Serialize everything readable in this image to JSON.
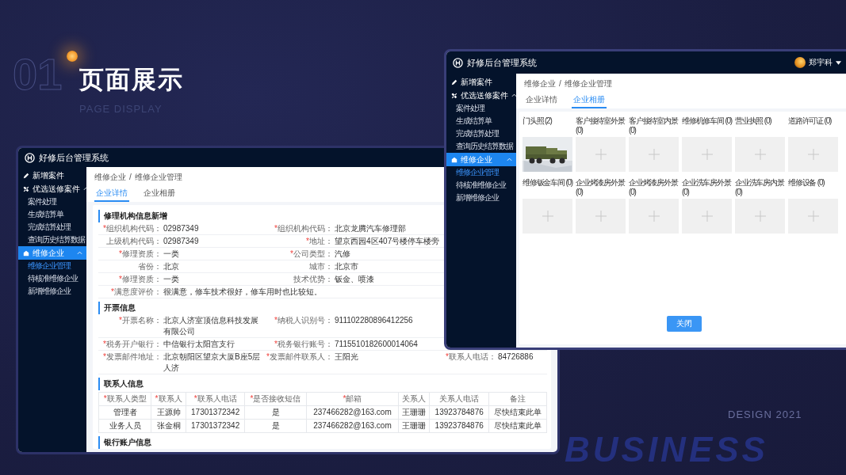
{
  "hero": {
    "number": "01",
    "title": "页面展示",
    "subtitle": "PAGE DISPLAY",
    "design_label": "DESIGN 2021",
    "backdrop_word": "BUSINESS"
  },
  "back_window": {
    "title": "好修后台管理系统",
    "sidebar": [
      {
        "label": "新增案件",
        "selected": false
      },
      {
        "label": "优选送修案件",
        "selected": false,
        "expanded": true,
        "children": [
          {
            "label": "案件处理",
            "selected": false
          },
          {
            "label": "生成结算单",
            "selected": false
          },
          {
            "label": "完成结算处理",
            "selected": false
          },
          {
            "label": "查询历史结算数据",
            "selected": false
          }
        ]
      },
      {
        "label": "维修企业",
        "selected": true,
        "expanded": true,
        "children": [
          {
            "label": "维修企业管理",
            "selected": true
          },
          {
            "label": "待核准维修企业",
            "selected": false
          },
          {
            "label": "新增维修企业",
            "selected": false
          }
        ]
      }
    ],
    "breadcrumb": {
      "items": [
        "维修企业",
        "维修企业管理"
      ],
      "separator": "/"
    },
    "tabs": [
      {
        "label": "企业详情",
        "selected": true
      },
      {
        "label": "企业相册",
        "selected": false
      }
    ],
    "sections": [
      {
        "title": "修理机构信息新增",
        "kind": "fields",
        "rows": [
          [
            {
              "mark": "*",
              "label": "组织机构代码：",
              "value": "02987349"
            },
            {
              "mark": "*",
              "label": "组织机构代码：",
              "value": "北京龙腾汽车修理部"
            }
          ],
          [
            {
              "label": "上级机构代码：",
              "value": "02987349"
            },
            {
              "mark": "*",
              "label": "地址：",
              "value": "望京西园4区407号楼停车楼旁"
            }
          ],
          [
            {
              "mark": "*",
              "label": "修理资质：",
              "value": "一类"
            },
            {
              "mark": "*",
              "label": "公司类型：",
              "value": "汽修"
            }
          ],
          [
            {
              "label": "省份：",
              "value": "北京"
            },
            {
              "label": "城市：",
              "value": "北京市"
            }
          ],
          [
            {
              "mark": "*",
              "label": "修理资质：",
              "value": "一类"
            },
            {
              "label": "技术优势：",
              "value": "钣金、喷漆"
            }
          ],
          [
            {
              "mark": "*",
              "label": "满意度评价：",
              "value": "很满意，修车技术很好，修车用时也比较短。"
            }
          ]
        ]
      },
      {
        "title": "开票信息",
        "kind": "fields",
        "rows": [
          [
            {
              "mark": "*",
              "label": "开票名称：",
              "value": "北京人济室顶信息科技发展有限公司"
            },
            {
              "mark": "*",
              "label": "纳税人识别号：",
              "value": "911102280896412256"
            }
          ],
          [
            {
              "mark": "*",
              "label": "税务开户银行：",
              "value": "中信银行太阳宫支行"
            },
            {
              "mark": "*",
              "label": "税务银行账号：",
              "value": "7115510182600014064"
            }
          ],
          [
            {
              "mark": "*",
              "label": "发票邮件地址：",
              "value": "北京朝阳区望京大厦B座5层人济"
            },
            {
              "mark": "*",
              "label": "发票邮件联系人：",
              "value": "王阳光"
            },
            {
              "mark": "*",
              "label": "联系人电话：",
              "value": "84726886"
            }
          ]
        ]
      },
      {
        "title": "联系人信息",
        "kind": "table",
        "columns": [
          {
            "mark": "*",
            "label": "联系人类型"
          },
          {
            "mark": "*",
            "label": "联系人"
          },
          {
            "mark": "*",
            "label": "联系人电话"
          },
          {
            "mark": "*",
            "label": "是否接收短信"
          },
          {
            "mark": "*",
            "label": "邮箱"
          },
          {
            "label": "关系人"
          },
          {
            "label": "关系人电话"
          },
          {
            "label": "备注"
          }
        ],
        "rows": [
          [
            "管理者",
            "王源帅",
            "17301372342",
            "是",
            "237466282@163.com",
            "王珊珊",
            "13923784876",
            "尽快结束此单"
          ],
          [
            "业务人员",
            "张金桐",
            "17301372342",
            "是",
            "237466282@163.com",
            "王珊珊",
            "13923784876",
            "尽快结束此单"
          ]
        ]
      },
      {
        "title": "银行账户信息",
        "kind": "empty"
      }
    ]
  },
  "front_window": {
    "title": "好修后台管理系统",
    "user": "郑宇科",
    "sidebar": [
      {
        "label": "新增案件",
        "selected": false
      },
      {
        "label": "优选送修案件",
        "selected": false,
        "expanded": true,
        "children": [
          {
            "label": "案件处理",
            "selected": false
          },
          {
            "label": "生成结算单",
            "selected": false
          },
          {
            "label": "完成结算处理",
            "selected": false
          },
          {
            "label": "查询历史结算数据",
            "selected": false
          }
        ]
      },
      {
        "label": "维修企业",
        "selected": true,
        "expanded": true,
        "children": [
          {
            "label": "维修企业管理",
            "selected": true
          },
          {
            "label": "待核准维修企业",
            "selected": false
          },
          {
            "label": "新增维修企业",
            "selected": false
          }
        ]
      }
    ],
    "breadcrumb": {
      "items": [
        "维修企业",
        "维修企业管理"
      ],
      "separator": "/"
    },
    "tabs": [
      {
        "label": "企业详情",
        "selected": false
      },
      {
        "label": "企业相册",
        "selected": true
      }
    ],
    "album": [
      {
        "label": "门头照 (2)",
        "kind": "picture"
      },
      {
        "label": "客户接待室外景 (0)",
        "kind": "empty"
      },
      {
        "label": "客户接待室内景 (0)",
        "kind": "empty"
      },
      {
        "label": "维修机修车间 (0)",
        "kind": "empty"
      },
      {
        "label": "营业执照 (0)",
        "kind": "empty"
      },
      {
        "label": "道路许可证 (0)",
        "kind": "empty"
      },
      {
        "label": "维修钣金车间 (0)",
        "kind": "empty"
      },
      {
        "label": "企业烤漆房外景 (0)",
        "kind": "empty"
      },
      {
        "label": "企业烤漆房外景 (0)",
        "kind": "empty"
      },
      {
        "label": "企业洗车房外景 (0)",
        "kind": "empty"
      },
      {
        "label": "企业洗车房内景 (0)",
        "kind": "empty"
      },
      {
        "label": "维修设备 (0)",
        "kind": "empty"
      }
    ],
    "close_button": "关闭"
  }
}
